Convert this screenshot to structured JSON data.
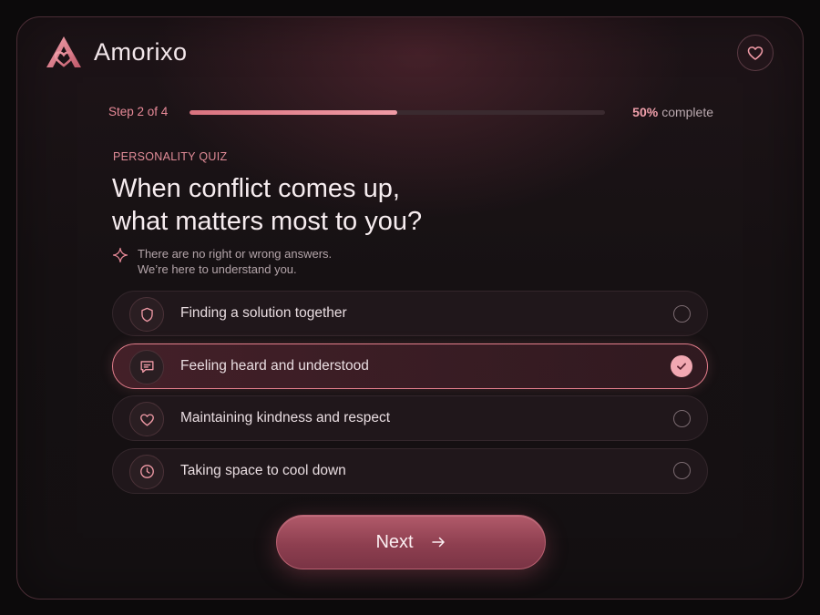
{
  "brand": {
    "name": "Amorixo"
  },
  "progress": {
    "step_label": "Step 2 of 4",
    "percent_value": "50%",
    "percent_suffix": "complete",
    "fraction": 0.5
  },
  "quiz": {
    "eyebrow": "PERSONALITY QUIZ",
    "title_line1": "When conflict comes up,",
    "title_line2": "what matters most to you?",
    "hint_line1": "There are no right or wrong answers.",
    "hint_line2": "We’re here to understand you."
  },
  "options": [
    {
      "label": "Finding a solution together",
      "icon": "shield-icon",
      "selected": false
    },
    {
      "label": "Feeling heard and understood",
      "icon": "chat-icon",
      "selected": true
    },
    {
      "label": "Maintaining kindness and respect",
      "icon": "heart-icon",
      "selected": false
    },
    {
      "label": "Taking space to cool down",
      "icon": "clock-icon",
      "selected": false
    }
  ],
  "actions": {
    "next_label": "Next"
  },
  "colors": {
    "accent": "#e88a98",
    "background": "#141012",
    "button": "#9a4656"
  }
}
